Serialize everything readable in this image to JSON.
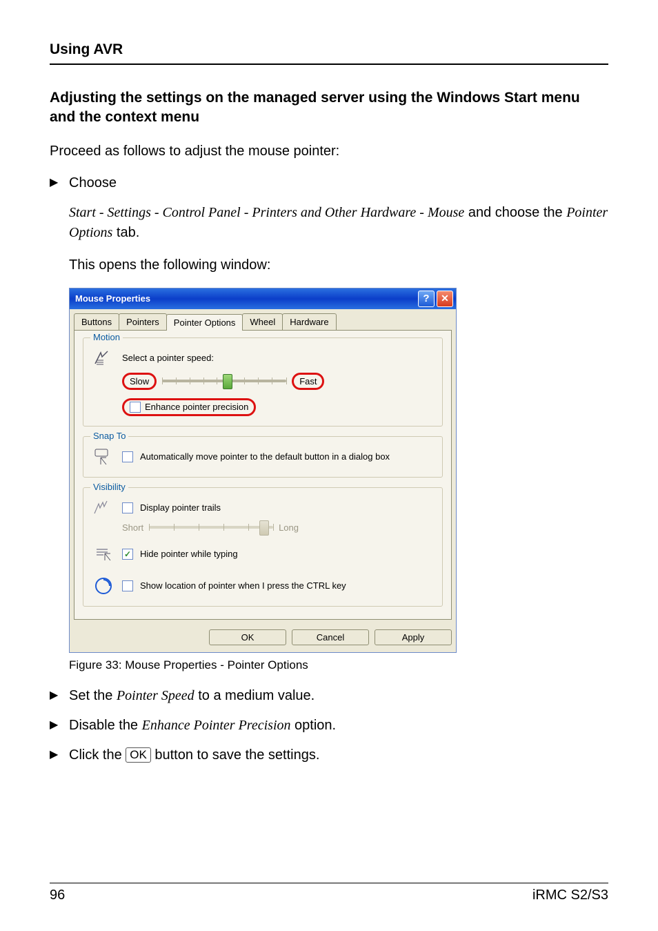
{
  "header": {
    "section": "Using AVR"
  },
  "subheading": "Adjusting the settings on the managed server using the Windows Start menu and the context menu",
  "intro": "Proceed as follows to adjust the mouse pointer:",
  "choose_label": "Choose",
  "path_text": "Start - Settings - Control Panel -  Printers and Other Hardware - Mouse",
  "path_tail": " and choose the ",
  "path_tab": "Pointer Options",
  "path_tail2": " tab.",
  "opens_text": "This opens the following window:",
  "dialog": {
    "title": "Mouse Properties",
    "tabs": {
      "buttons": "Buttons",
      "pointers": "Pointers",
      "pointer_options": "Pointer Options",
      "wheel": "Wheel",
      "hardware": "Hardware"
    },
    "motion": {
      "legend": "Motion",
      "select_speed": "Select a pointer speed:",
      "slow": "Slow",
      "fast": "Fast",
      "enhance": "Enhance pointer precision"
    },
    "snap": {
      "legend": "Snap To",
      "auto_move": "Automatically move pointer to the default button in a dialog box"
    },
    "visibility": {
      "legend": "Visibility",
      "trails": "Display pointer trails",
      "short": "Short",
      "long": "Long",
      "hide_typing": "Hide pointer while typing",
      "show_ctrl": "Show location of pointer when I press the CTRL key"
    },
    "buttons_row": {
      "ok": "OK",
      "cancel": "Cancel",
      "apply": "Apply"
    }
  },
  "caption": "Figure 33: Mouse Properties - Pointer Options",
  "steps": {
    "set_speed_pre": "Set the ",
    "set_speed_it": "Pointer Speed",
    "set_speed_post": " to a medium value.",
    "disable_pre": "Disable the ",
    "disable_it": "Enhance Pointer Precision",
    "disable_post": " option.",
    "click_pre": "Click the ",
    "ok_key": "OK",
    "click_post": " button to save the settings."
  },
  "footer": {
    "page": "96",
    "doc": "iRMC S2/S3"
  }
}
